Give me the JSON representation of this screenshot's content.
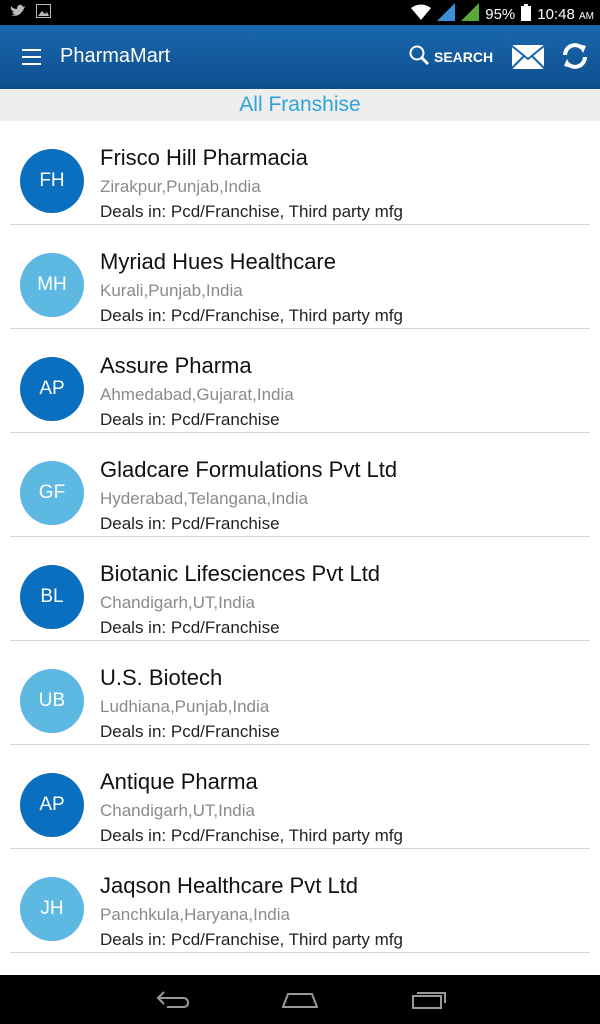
{
  "status_bar": {
    "battery": "95%",
    "time": "10:48",
    "ampm": "AM"
  },
  "app_bar": {
    "title": "PharmaMart",
    "search_label": "SEARCH"
  },
  "section": {
    "title": "All Franshise"
  },
  "colors": {
    "app_bar": "#1a67ad",
    "accent": "#2ea3dc",
    "avatar_dark": "#0a6fbe",
    "avatar_light": "#5db8e2"
  },
  "items": [
    {
      "initials": "FH",
      "name": "Frisco Hill Pharmacia",
      "location": "Zirakpur,Punjab,India",
      "deals": "Deals in: Pcd/Franchise, Third party mfg"
    },
    {
      "initials": "MH",
      "name": "Myriad Hues Healthcare",
      "location": "Kurali,Punjab,India",
      "deals": "Deals in: Pcd/Franchise, Third party mfg"
    },
    {
      "initials": "AP",
      "name": "Assure Pharma",
      "location": "Ahmedabad,Gujarat,India",
      "deals": "Deals in: Pcd/Franchise"
    },
    {
      "initials": "GF",
      "name": "Gladcare Formulations Pvt Ltd",
      "location": "Hyderabad,Telangana,India",
      "deals": "Deals in: Pcd/Franchise"
    },
    {
      "initials": "BL",
      "name": "Biotanic Lifesciences Pvt Ltd",
      "location": "Chandigarh,UT,India",
      "deals": "Deals in: Pcd/Franchise"
    },
    {
      "initials": "UB",
      "name": "U.S. Biotech",
      "location": "Ludhiana,Punjab,India",
      "deals": "Deals in: Pcd/Franchise"
    },
    {
      "initials": "AP",
      "name": "Antique Pharma",
      "location": "Chandigarh,UT,India",
      "deals": "Deals in: Pcd/Franchise, Third party mfg"
    },
    {
      "initials": "JH",
      "name": "Jaqson Healthcare Pvt Ltd",
      "location": "Panchkula,Haryana,India",
      "deals": "Deals in: Pcd/Franchise, Third party mfg"
    }
  ]
}
